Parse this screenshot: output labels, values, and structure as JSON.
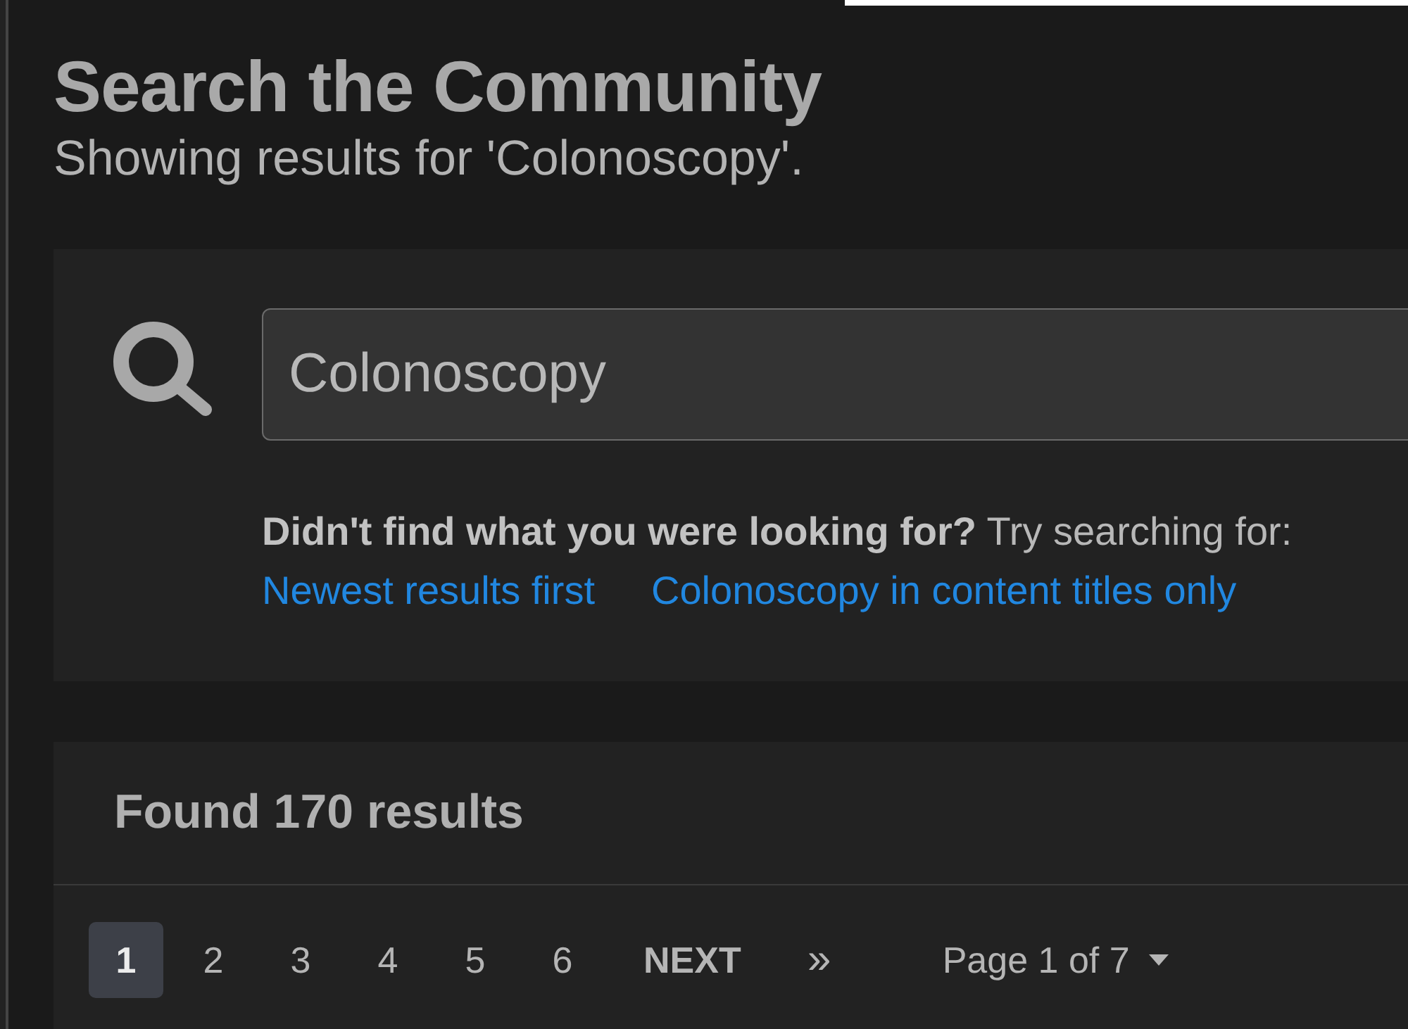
{
  "header": {
    "title": "Search the Community",
    "subtitle": "Showing results for 'Colonoscopy'."
  },
  "search": {
    "value": "Colonoscopy",
    "hint": "**Didn't find what you were looking for?** Try searching for:",
    "suggestions": [
      "Newest results first",
      "Colonoscopy in content titles only"
    ]
  },
  "results": {
    "count_text": "Found 170 results",
    "pagination": {
      "pages": [
        {
          "label": "1",
          "selected": true
        },
        {
          "label": "2",
          "selected": false
        },
        {
          "label": "3",
          "selected": false
        },
        {
          "label": "4",
          "selected": false
        },
        {
          "label": "5",
          "selected": false
        },
        {
          "label": "6",
          "selected": false
        }
      ],
      "next": "NEXT",
      "last": "»",
      "page_select": "Page 1 of 7"
    }
  }
}
